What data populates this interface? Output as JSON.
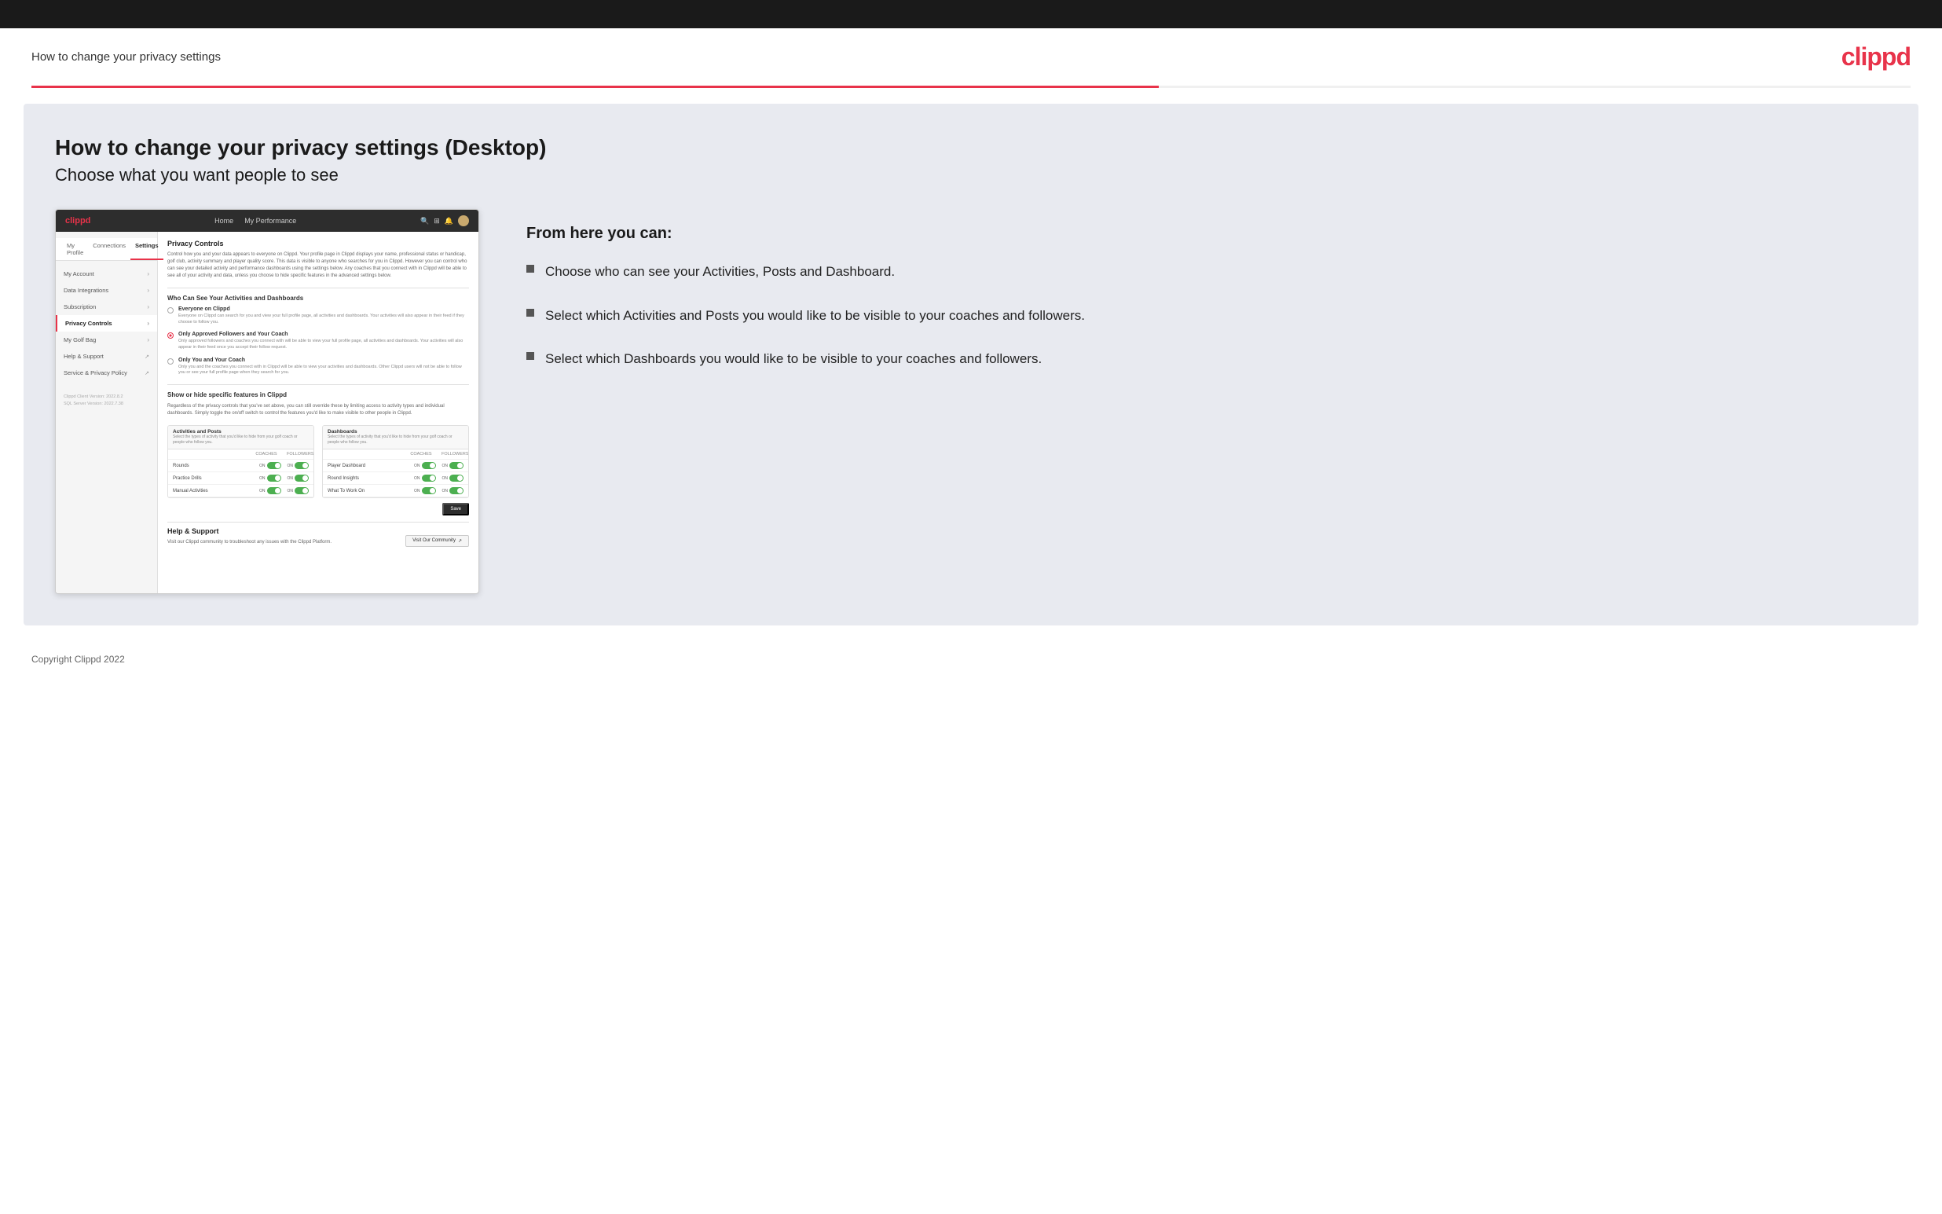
{
  "topBar": {},
  "header": {
    "title": "How to change your privacy settings",
    "logo": "clippd"
  },
  "mainContent": {
    "heading": "How to change your privacy settings (Desktop)",
    "subheading": "Choose what you want people to see"
  },
  "mockup": {
    "nav": {
      "logo": "clippd",
      "links": [
        "Home",
        "My Performance"
      ]
    },
    "tabBar": {
      "tabs": [
        "My Profile",
        "Connections",
        "Settings"
      ]
    },
    "sidebar": {
      "items": [
        {
          "label": "My Account",
          "active": false
        },
        {
          "label": "Data Integrations",
          "active": false
        },
        {
          "label": "Subscription",
          "active": false
        },
        {
          "label": "Privacy Controls",
          "active": true
        },
        {
          "label": "My Golf Bag",
          "active": false
        },
        {
          "label": "Help & Support",
          "active": false,
          "external": true
        },
        {
          "label": "Service & Privacy Policy",
          "active": false,
          "external": true
        }
      ],
      "version": "Clippd Client Version: 2022.8.2\nSQL Server Version: 2022.7.38"
    },
    "mainPanel": {
      "sectionTitle": "Privacy Controls",
      "description": "Control how you and your data appears to everyone on Clippd. Your profile page in Clippd displays your name, professional status or handicap, golf club, activity summary and player quality score. This data is visible to anyone who searches for you in Clippd. However you can control who can see your detailed activity and performance dashboards using the settings below. Any coaches that you connect with in Clippd will be able to see all of your activity and data, unless you choose to hide specific features in the advanced settings below.",
      "whoCanSeeTitle": "Who Can See Your Activities and Dashboards",
      "radioOptions": [
        {
          "label": "Everyone on Clippd",
          "description": "Everyone on Clippd can search for you and view your full profile page, all activities and dashboards. Your activities will also appear in their feed if they choose to follow you.",
          "selected": false
        },
        {
          "label": "Only Approved Followers and Your Coach",
          "description": "Only approved followers and coaches you connect with will be able to view your full profile page, all activities and dashboards. Your activities will also appear in their feed once you accept their follow request.",
          "selected": true
        },
        {
          "label": "Only You and Your Coach",
          "description": "Only you and the coaches you connect with in Clippd will be able to view your activities and dashboards. Other Clippd users will not be able to follow you or see your full profile page when they search for you.",
          "selected": false
        }
      ],
      "showHideTitle": "Show or hide specific features in Clippd",
      "showHideDescription": "Regardless of the privacy controls that you've set above, you can still override these by limiting access to activity types and individual dashboards. Simply toggle the on/off switch to control the features you'd like to make visible to other people in Clippd.",
      "activitiesTable": {
        "header": "Activities and Posts",
        "subheader": "Select the types of activity that you'd like to hide from your golf coach or people who follow you.",
        "colHeaders": [
          "COACHES",
          "FOLLOWERS"
        ],
        "rows": [
          {
            "label": "Rounds",
            "coachesOn": true,
            "followersOn": true
          },
          {
            "label": "Practice Drills",
            "coachesOn": true,
            "followersOn": true
          },
          {
            "label": "Manual Activities",
            "coachesOn": true,
            "followersOn": true
          }
        ]
      },
      "dashboardsTable": {
        "header": "Dashboards",
        "subheader": "Select the types of activity that you'd like to hide from your golf coach or people who follow you.",
        "colHeaders": [
          "COACHES",
          "FOLLOWERS"
        ],
        "rows": [
          {
            "label": "Player Dashboard",
            "coachesOn": true,
            "followersOn": true
          },
          {
            "label": "Round Insights",
            "coachesOn": true,
            "followersOn": true
          },
          {
            "label": "What To Work On",
            "coachesOn": true,
            "followersOn": true
          }
        ]
      },
      "saveButton": "Save",
      "helpSection": {
        "label": "Help & Support",
        "description": "Visit our Clippd community to troubleshoot any issues with the Clippd Platform.",
        "button": "Visit Our Community"
      }
    }
  },
  "rightPanel": {
    "heading": "From here you can:",
    "bullets": [
      "Choose who can see your Activities, Posts and Dashboard.",
      "Select which Activities and Posts you would like to be visible to your coaches and followers.",
      "Select which Dashboards you would like to be visible to your coaches and followers."
    ]
  },
  "footer": {
    "text": "Copyright Clippd 2022"
  }
}
